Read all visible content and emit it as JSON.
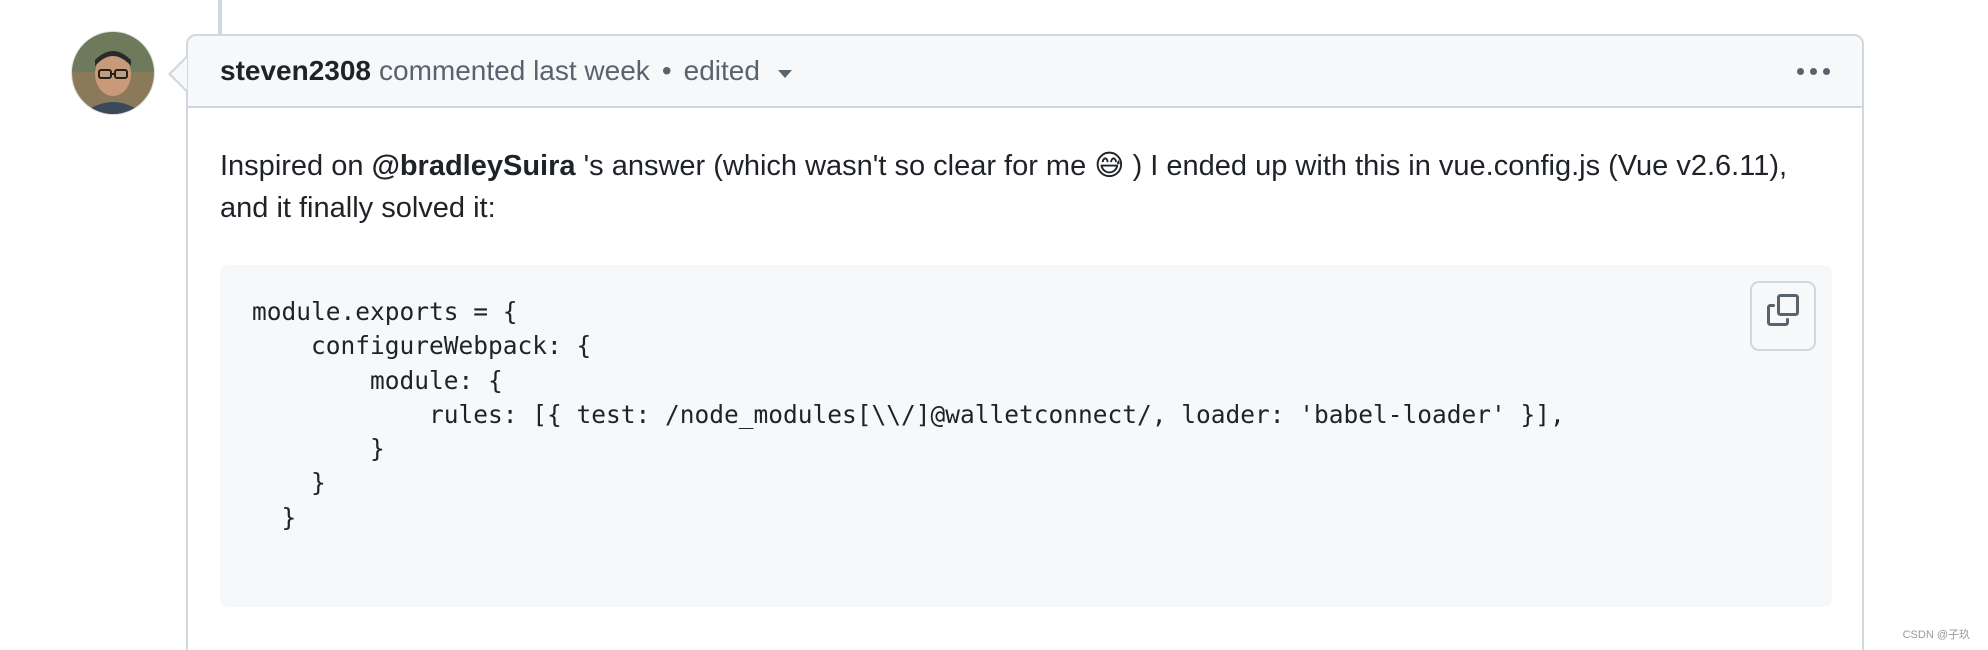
{
  "comment": {
    "author": "steven2308",
    "action_text": "commented last week",
    "separator": "•",
    "edited_label": "edited",
    "menu_icon": "kebab-horizontal-icon",
    "body": {
      "prefix": "Inspired on",
      "mention": "@bradleySuira",
      "middle": "'s answer (which wasn't so clear for me",
      "emoji": "😅",
      "suffix": ") I ended up with this in vue.config.js (Vue v2.6.11), and it finally solved it:"
    },
    "code": "module.exports = {\n    configureWebpack: {\n        module: {\n            rules: [{ test: /node_modules[\\\\/]@walletconnect/, loader: 'babel-loader' }],\n        }\n    }\n  }",
    "copy_icon": "copy-icon"
  },
  "watermark": "CSDN @子玖",
  "colors": {
    "border": "#d0d7de",
    "header_bg": "#f6f8fa",
    "muted_text": "#59636e",
    "text": "#1f2328"
  }
}
